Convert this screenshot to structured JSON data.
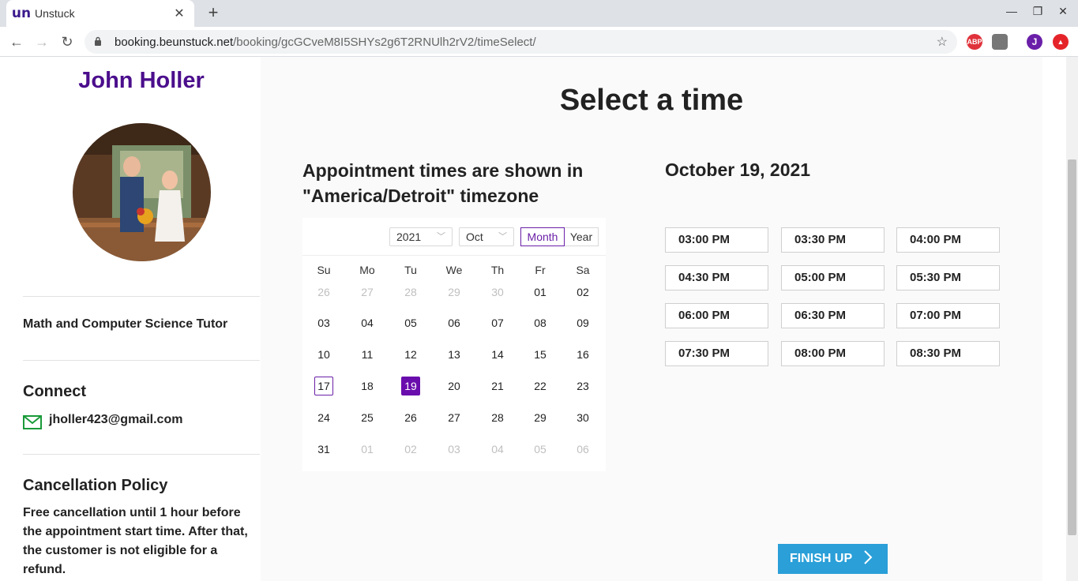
{
  "browser": {
    "tab_title": "Unstuck",
    "tab_favicon": "un",
    "url_host": "booking.beunstuck.net",
    "url_path": "/booking/gcGCveM8I5SHYs2g6T2RNUlh2rV2/timeSelect/",
    "profile_initial": "J",
    "ext_abp": "ABP"
  },
  "sidebar": {
    "tutor_name": "John Holler",
    "subtitle": "Math and Computer Science Tutor",
    "connect_heading": "Connect",
    "email": "jholler423@gmail.com",
    "policy_heading": "Cancellation Policy",
    "policy_text": "Free cancellation until 1 hour before the appointment start time. After that, the customer is not eligible for a refund."
  },
  "main": {
    "heading": "Select a time",
    "timezone_note": "Appointment times are shown in \"America/Detroit\" timezone",
    "selected_date": "October 19, 2021",
    "finish_label": "FINISH UP"
  },
  "calendar": {
    "year": "2021",
    "month": "Oct",
    "mode_month": "Month",
    "mode_year": "Year",
    "weekdays": [
      "Su",
      "Mo",
      "Tu",
      "We",
      "Th",
      "Fr",
      "Sa"
    ],
    "weeks": [
      [
        {
          "d": "26",
          "m": true
        },
        {
          "d": "27",
          "m": true
        },
        {
          "d": "28",
          "m": true
        },
        {
          "d": "29",
          "m": true
        },
        {
          "d": "30",
          "m": true
        },
        {
          "d": "01"
        },
        {
          "d": "02"
        }
      ],
      [
        {
          "d": "03"
        },
        {
          "d": "04"
        },
        {
          "d": "05"
        },
        {
          "d": "06"
        },
        {
          "d": "07"
        },
        {
          "d": "08"
        },
        {
          "d": "09"
        }
      ],
      [
        {
          "d": "10"
        },
        {
          "d": "11"
        },
        {
          "d": "12"
        },
        {
          "d": "13"
        },
        {
          "d": "14"
        },
        {
          "d": "15"
        },
        {
          "d": "16"
        }
      ],
      [
        {
          "d": "17",
          "today": true
        },
        {
          "d": "18"
        },
        {
          "d": "19",
          "selected": true
        },
        {
          "d": "20"
        },
        {
          "d": "21"
        },
        {
          "d": "22"
        },
        {
          "d": "23"
        }
      ],
      [
        {
          "d": "24"
        },
        {
          "d": "25"
        },
        {
          "d": "26"
        },
        {
          "d": "27"
        },
        {
          "d": "28"
        },
        {
          "d": "29"
        },
        {
          "d": "30"
        }
      ],
      [
        {
          "d": "31"
        },
        {
          "d": "01",
          "m": true
        },
        {
          "d": "02",
          "m": true
        },
        {
          "d": "03",
          "m": true
        },
        {
          "d": "04",
          "m": true
        },
        {
          "d": "05",
          "m": true
        },
        {
          "d": "06",
          "m": true
        }
      ]
    ]
  },
  "time_slots": [
    "03:00 PM",
    "03:30 PM",
    "04:00 PM",
    "04:30 PM",
    "05:00 PM",
    "05:30 PM",
    "06:00 PM",
    "06:30 PM",
    "07:00 PM",
    "07:30 PM",
    "08:00 PM",
    "08:30 PM"
  ],
  "colors": {
    "brand_purple": "#4b0e8c",
    "selected_day": "#6a0dad",
    "finish_button": "#2a9fd8",
    "mail_icon": "#1a9a3a"
  }
}
